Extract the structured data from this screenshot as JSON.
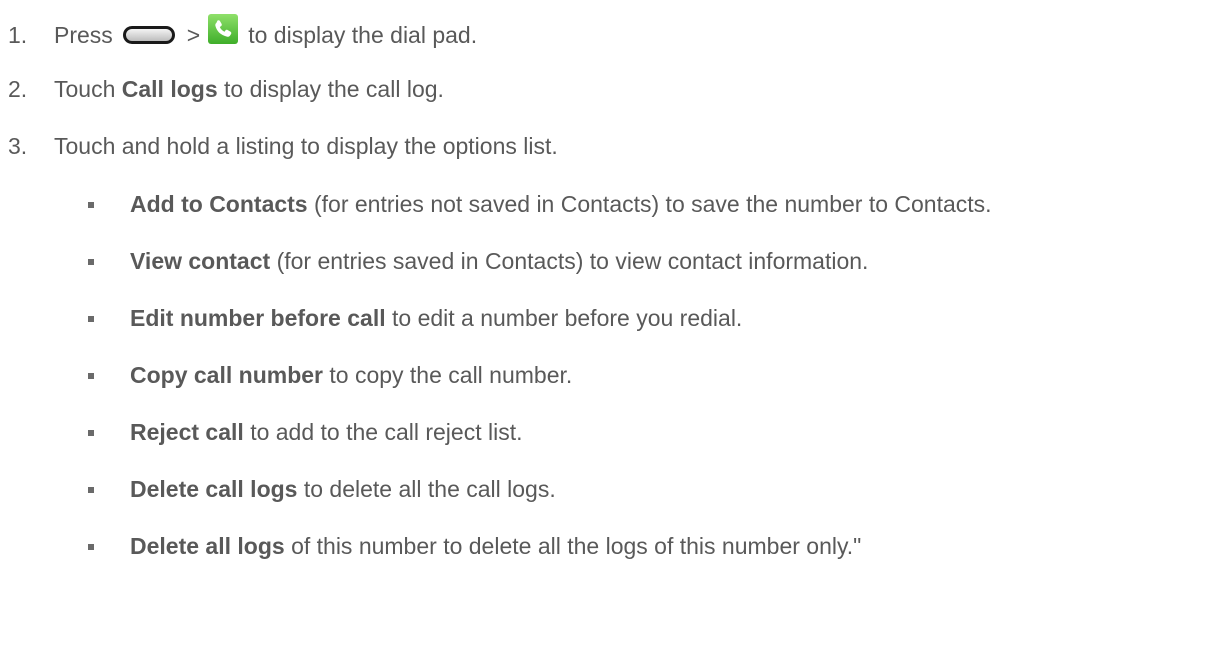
{
  "steps": [
    {
      "num": "1.",
      "pre": "Press",
      "sep": ">",
      "post": "to display the dial pad.",
      "icons": [
        "home-key-icon",
        "phone-app-icon"
      ]
    },
    {
      "num": "2.",
      "pre": "Touch",
      "bold": "Call logs",
      "post": "to display the call log."
    },
    {
      "num": "3.",
      "text": "Touch and hold a listing to display the options list."
    }
  ],
  "options": [
    {
      "bold": "Add to Contacts",
      "rest": "(for entries not saved in Contacts) to save the number to Contacts."
    },
    {
      "bold": "View contact",
      "rest": "(for entries saved in Contacts) to view contact information."
    },
    {
      "bold": "Edit number before call",
      "rest": "to edit a number before you redial."
    },
    {
      "bold": "Copy call number",
      "rest": "to copy the call number."
    },
    {
      "bold": "Reject call",
      "rest": "to add to the call reject list."
    },
    {
      "bold": "Delete call logs",
      "rest": "to delete all the call logs."
    },
    {
      "bold": "Delete all logs",
      "rest": "of this number to delete all the logs of this number only.\""
    }
  ],
  "colors": {
    "text": "#595959",
    "phone_icon": "#4cb82f"
  }
}
